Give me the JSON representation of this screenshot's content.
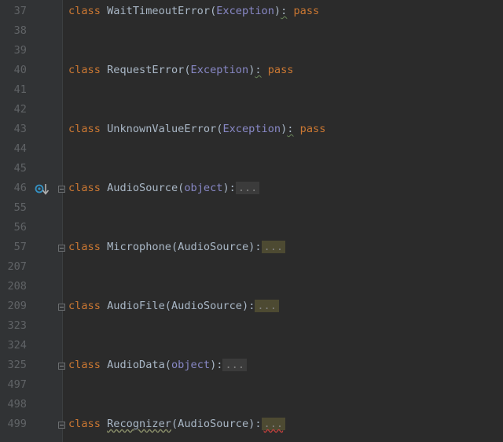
{
  "lines": [
    {
      "num": "37",
      "kw": "class",
      "name": "WaitTimeoutError",
      "open": "(",
      "base": "Exception",
      "close": ")",
      "colon": ":",
      "tail": "pass"
    },
    {
      "num": "38"
    },
    {
      "num": "39"
    },
    {
      "num": "40",
      "kw": "class",
      "name": "RequestError",
      "open": "(",
      "base": "Exception",
      "close": ")",
      "colon": ":",
      "tail": "pass"
    },
    {
      "num": "41"
    },
    {
      "num": "42"
    },
    {
      "num": "43",
      "kw": "class",
      "name": "UnknownValueError",
      "open": "(",
      "base": "Exception",
      "close": ")",
      "colon": ":",
      "tail": "pass"
    },
    {
      "num": "44"
    },
    {
      "num": "45"
    },
    {
      "num": "46",
      "kw": "class",
      "name": "AudioSource",
      "open": "(",
      "base": "object",
      "close": ")",
      "colon": ":",
      "folded": "..."
    },
    {
      "num": "55"
    },
    {
      "num": "56"
    },
    {
      "num": "57",
      "kw": "class",
      "name": "Microphone",
      "open": "(",
      "base": "AudioSource",
      "close": ")",
      "colon": ":",
      "folded": "..."
    },
    {
      "num": "207"
    },
    {
      "num": "208"
    },
    {
      "num": "209",
      "kw": "class",
      "name": "AudioFile",
      "open": "(",
      "base": "AudioSource",
      "close": ")",
      "colon": ":",
      "folded": "..."
    },
    {
      "num": "323"
    },
    {
      "num": "324"
    },
    {
      "num": "325",
      "kw": "class",
      "name": "AudioData",
      "open": "(",
      "base": "object",
      "close": ")",
      "colon": ":",
      "folded": "..."
    },
    {
      "num": "497"
    },
    {
      "num": "498"
    },
    {
      "num": "499",
      "kw": "class",
      "name": "Recognizer",
      "open": "(",
      "base": "AudioSource",
      "close": ")",
      "colon": ":",
      "folded": "..."
    }
  ],
  "colors": {
    "background": "#2b2b2b",
    "keyword": "#cc7832",
    "builtin": "#8888c6",
    "text": "#a9b7c6",
    "line_number": "#606366",
    "override_marker": "#3592c4"
  },
  "gutter_icons": {
    "46": "overridden-method-icon"
  }
}
